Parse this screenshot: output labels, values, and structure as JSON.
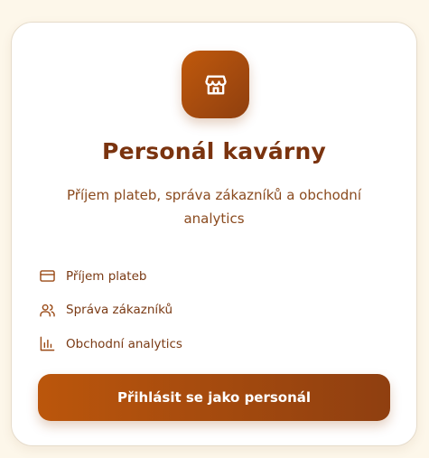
{
  "card": {
    "logo_icon": "store-icon",
    "title": "Personál kavárny",
    "subtitle": "Příjem plateb, správa zákazníků a obchodní analytics",
    "features": [
      {
        "icon": "credit-card-icon",
        "label": "Příjem plateb"
      },
      {
        "icon": "users-icon",
        "label": "Správa zákazníků"
      },
      {
        "icon": "bar-chart-icon",
        "label": "Obchodní analytics"
      }
    ],
    "login_button_label": "Přihlásit se jako personál"
  },
  "colors": {
    "page_background": "#fdf7ea",
    "accent_start": "#c0590c",
    "accent_end": "#8f3f0f",
    "title": "#7a330f",
    "text": "#8a4a1e"
  }
}
